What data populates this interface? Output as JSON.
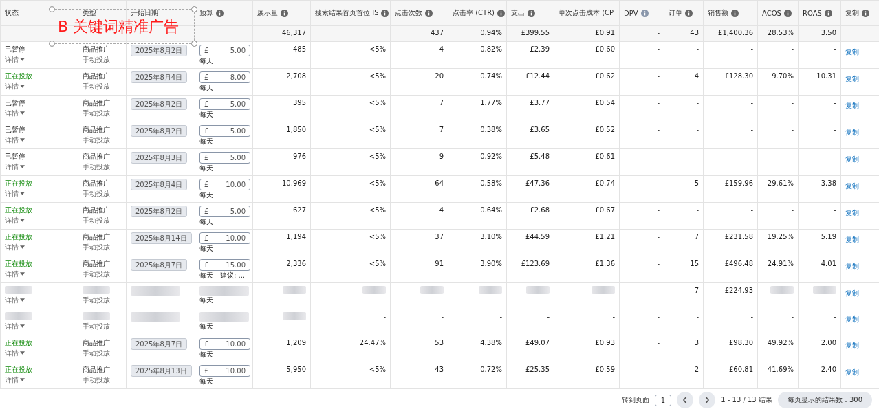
{
  "annotation": {
    "text": "B 关键词精准广告"
  },
  "columns": [
    {
      "label": "状态"
    },
    {
      "label": "类型"
    },
    {
      "label": "开始日期"
    },
    {
      "label": "预算",
      "info": true
    },
    {
      "label": "展示量",
      "info": true
    },
    {
      "label": "搜索结果首页首位 IS",
      "info": true
    },
    {
      "label": "点击次数",
      "info": true
    },
    {
      "label": "点击率 (CTR)",
      "info": true
    },
    {
      "label": "支出",
      "info": true
    },
    {
      "label": "单次点击成本 (CP"
    },
    {
      "label": "DPV",
      "info": true,
      "info_muted": true
    },
    {
      "label": "订单",
      "info": true
    },
    {
      "label": "销售额",
      "info": true
    },
    {
      "label": "ACOS",
      "info": true
    },
    {
      "label": "ROAS",
      "info": true
    },
    {
      "label": "复制",
      "info": true
    }
  ],
  "totals": {
    "impressions": "46,317",
    "clicks": "437",
    "ctr": "0.94%",
    "spend": "£399.55",
    "cpc": "£0.91",
    "dpv": "-",
    "orders": "43",
    "sales": "£1,400.36",
    "acos": "28.53%",
    "roas": "3.50"
  },
  "rows": [
    {
      "status": "已暂停",
      "running": false,
      "details": "详情",
      "type": "商品推广",
      "targeting": "手动投放",
      "start_date": "2025年8月2日",
      "currency": "£",
      "budget": "5.00",
      "budget_note": "每天",
      "metrics": [
        "485",
        "<5%",
        "4",
        "0.82%",
        "£2.39",
        "£0.60",
        "-",
        "-",
        "-",
        "-",
        "-"
      ],
      "copy": "复制"
    },
    {
      "status": "正在投放",
      "running": true,
      "details": "详情",
      "type": "商品推广",
      "targeting": "手动投放",
      "start_date": "2025年8月4日",
      "currency": "£",
      "budget": "8.00",
      "budget_note": "每天",
      "metrics": [
        "2,708",
        "<5%",
        "20",
        "0.74%",
        "£12.44",
        "£0.62",
        "-",
        "4",
        "£128.30",
        "9.70%",
        "10.31"
      ],
      "copy": "复制"
    },
    {
      "status": "已暂停",
      "running": false,
      "details": "详情",
      "type": "商品推广",
      "targeting": "手动投放",
      "start_date": "2025年8月2日",
      "currency": "£",
      "budget": "5.00",
      "budget_note": "每天",
      "metrics": [
        "395",
        "<5%",
        "7",
        "1.77%",
        "£3.77",
        "£0.54",
        "-",
        "-",
        "-",
        "-",
        "-"
      ],
      "copy": "复制"
    },
    {
      "status": "已暂停",
      "running": false,
      "details": "详情",
      "type": "商品推广",
      "targeting": "手动投放",
      "start_date": "2025年8月2日",
      "currency": "£",
      "budget": "5.00",
      "budget_note": "每天",
      "metrics": [
        "1,850",
        "<5%",
        "7",
        "0.38%",
        "£3.65",
        "£0.52",
        "-",
        "-",
        "-",
        "-",
        "-"
      ],
      "copy": "复制"
    },
    {
      "status": "已暂停",
      "running": false,
      "details": "详情",
      "type": "商品推广",
      "targeting": "手动投放",
      "start_date": "2025年8月3日",
      "currency": "£",
      "budget": "5.00",
      "budget_note": "每天",
      "metrics": [
        "976",
        "<5%",
        "9",
        "0.92%",
        "£5.48",
        "£0.61",
        "-",
        "-",
        "-",
        "-",
        "-"
      ],
      "copy": "复制"
    },
    {
      "status": "正在投放",
      "running": true,
      "details": "详情",
      "type": "商品推广",
      "targeting": "手动投放",
      "start_date": "2025年8月4日",
      "currency": "£",
      "budget": "10.00",
      "budget_note": "每天",
      "metrics": [
        "10,969",
        "<5%",
        "64",
        "0.58%",
        "£47.36",
        "£0.74",
        "-",
        "5",
        "£159.96",
        "29.61%",
        "3.38"
      ],
      "copy": "复制"
    },
    {
      "status": "正在投放",
      "running": true,
      "details": "详情",
      "type": "商品推广",
      "targeting": "手动投放",
      "start_date": "2025年8月2日",
      "currency": "£",
      "budget": "5.00",
      "budget_note": "每天",
      "metrics": [
        "627",
        "<5%",
        "4",
        "0.64%",
        "£2.68",
        "£0.67",
        "-",
        "-",
        "-",
        "-",
        "-"
      ],
      "copy": "复制"
    },
    {
      "status": "正在投放",
      "running": true,
      "details": "详情",
      "type": "商品推广",
      "targeting": "手动投放",
      "start_date": "2025年8月14日",
      "currency": "£",
      "budget": "10.00",
      "budget_note": "每天",
      "metrics": [
        "1,194",
        "<5%",
        "37",
        "3.10%",
        "£44.59",
        "£1.21",
        "-",
        "7",
        "£231.58",
        "19.25%",
        "5.19"
      ],
      "copy": "复制"
    },
    {
      "status": "正在投放",
      "running": true,
      "details": "详情",
      "type": "商品推广",
      "targeting": "手动投放",
      "start_date": "2025年8月7日",
      "currency": "£",
      "budget": "15.00",
      "budget_note": "每天 - 建议: ...",
      "metrics": [
        "2,336",
        "<5%",
        "91",
        "3.90%",
        "£123.69",
        "£1.36",
        "-",
        "15",
        "£496.48",
        "24.91%",
        "4.01"
      ],
      "copy": "复制"
    },
    {
      "details": "详情",
      "targeting": "手动投放",
      "budget_note": "每天",
      "metrics": [
        {
          "kind": "blurred"
        },
        {
          "kind": "blurred"
        },
        {
          "kind": "blurred"
        },
        {
          "kind": "blurred"
        },
        {
          "kind": "blurred"
        },
        {
          "kind": "blurred"
        },
        {
          "kind": "text",
          "value": "-"
        },
        {
          "kind": "text",
          "value": "7"
        },
        {
          "kind": "text",
          "value": "£224.93"
        },
        {
          "kind": "blurred"
        },
        {
          "kind": "blurred"
        }
      ],
      "copy": "复制"
    },
    {
      "details": "详情",
      "targeting": "手动投放",
      "budget_note": "每天",
      "metrics": [
        {
          "kind": "blurred"
        },
        {
          "kind": "text",
          "value": "-"
        },
        {
          "kind": "text",
          "value": "-"
        },
        {
          "kind": "text",
          "value": "-"
        },
        {
          "kind": "text",
          "value": "-"
        },
        {
          "kind": "text",
          "value": "-"
        },
        {
          "kind": "text",
          "value": "-"
        },
        {
          "kind": "text",
          "value": "-"
        },
        {
          "kind": "text",
          "value": "-"
        },
        {
          "kind": "text",
          "value": "-"
        },
        {
          "kind": "text",
          "value": "-"
        }
      ],
      "copy": "复制"
    },
    {
      "status": "正在投放",
      "running": true,
      "details": "详情",
      "type": "商品推广",
      "targeting": "手动投放",
      "start_date": "2025年8月7日",
      "currency": "£",
      "budget": "10.00",
      "budget_note": "每天",
      "metrics": [
        "1,209",
        "24.47%",
        "53",
        "4.38%",
        "£49.07",
        "£0.93",
        "-",
        "3",
        "£98.30",
        "49.92%",
        "2.00"
      ],
      "copy": "复制"
    },
    {
      "status": "正在投放",
      "running": true,
      "details": "详情",
      "type": "商品推广",
      "targeting": "手动投放",
      "start_date": "2025年8月13日",
      "currency": "£",
      "budget": "10.00",
      "budget_note": "每天",
      "metrics": [
        "5,950",
        "<5%",
        "43",
        "0.72%",
        "£25.35",
        "£0.59",
        "-",
        "2",
        "£60.81",
        "41.69%",
        "2.40"
      ],
      "copy": "复制"
    }
  ],
  "pagination": {
    "goto_label": "转到页面",
    "page": "1",
    "range": "1 - 13 / 13 结果",
    "per_page": "每页显示的结果数：300"
  }
}
